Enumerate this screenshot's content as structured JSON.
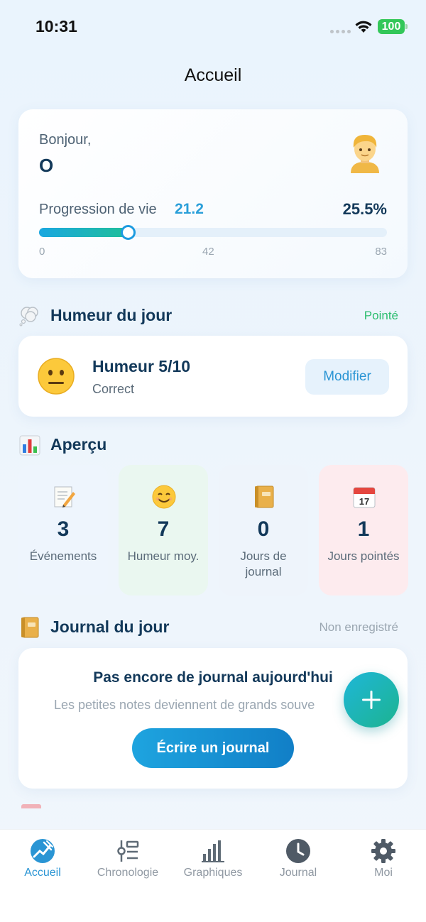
{
  "status_bar": {
    "time": "10:31",
    "battery": "100"
  },
  "nav": {
    "title": "Accueil"
  },
  "hero": {
    "greeting": "Bonjour,",
    "name": "O",
    "progress_label": "Progression de vie",
    "progress_value": "21.2",
    "progress_percent": "25.5%",
    "progress_fraction": 0.255,
    "scale": [
      "0",
      "42",
      "83"
    ]
  },
  "mood_section": {
    "title": "Humeur du jour",
    "status": "Pointé",
    "status_color": "#2bbd6e"
  },
  "mood_card": {
    "title": "Humeur 5/10",
    "subtitle": "Correct",
    "button": "Modifier"
  },
  "overview": {
    "title": "Aperçu",
    "stats": [
      {
        "value": "3",
        "label": "Événements",
        "icon": "memo-icon",
        "bg": "#eef5fd"
      },
      {
        "value": "7",
        "label": "Humeur moy.",
        "icon": "smile-icon",
        "bg": "#eaf7f0"
      },
      {
        "value": "0",
        "label": "Jours de journal",
        "icon": "notebook-icon",
        "bg": "#eef4fb"
      },
      {
        "value": "1",
        "label": "Jours pointés",
        "icon": "calendar-icon",
        "bg": "#fdebee"
      }
    ]
  },
  "journal_section": {
    "title": "Journal du jour",
    "status": "Non enregistré",
    "status_color": "#9aa6b1"
  },
  "journal_card": {
    "title": "Pas encore de journal aujourd'hui",
    "hint": "Les petites notes deviennent de grands souve",
    "button": "Écrire un journal"
  },
  "colors": {
    "accent": "#2a95d4",
    "title": "#13395a",
    "teal": "#1cb490"
  },
  "tabs": [
    {
      "label": "Accueil",
      "icon": "home-chart-icon",
      "active": true
    },
    {
      "label": "Chronologie",
      "icon": "timeline-icon",
      "active": false
    },
    {
      "label": "Graphiques",
      "icon": "bar-chart-icon",
      "active": false
    },
    {
      "label": "Journal",
      "icon": "clock-icon",
      "active": false
    },
    {
      "label": "Moi",
      "icon": "gear-icon",
      "active": false
    }
  ]
}
